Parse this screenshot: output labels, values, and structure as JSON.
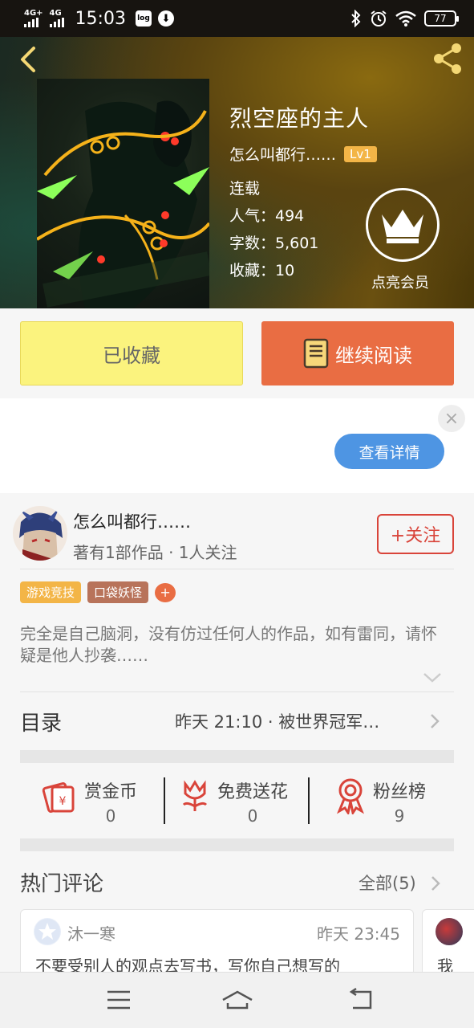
{
  "status_bar": {
    "signal1": "4G+",
    "signal2": "4G",
    "time": "15:03",
    "log_badge": "log",
    "battery": "77"
  },
  "book": {
    "title": "烈空座的主人",
    "author": "怎么叫都行……",
    "level": "Lv1",
    "status": "连载",
    "popularity": "人气：494",
    "words": "字数：5,601",
    "favorites": "收藏：10",
    "vip_label": "点亮会员"
  },
  "actions": {
    "favorited_label": "已收藏",
    "continue_label": "继续阅读"
  },
  "ad": {
    "details_label": "查看详情"
  },
  "author": {
    "name": "怎么叫都行……",
    "meta": "著有1部作品 · 1人关注",
    "follow_label": "+关注",
    "tags": [
      {
        "label": "游戏竞技",
        "color": "#f3b547"
      },
      {
        "label": "口袋妖怪",
        "color": "#b8735a"
      }
    ],
    "tag_plus": "+",
    "description": "完全是自己脑洞，没有仿过任何人的作品，如有雷同，请怀疑是他人抄袭……"
  },
  "catalog": {
    "title": "目录",
    "latest": "昨天 21:10 · 被世界冠军…"
  },
  "stats": [
    {
      "label": "赏金币",
      "value": "0",
      "icon": "red-envelope-icon"
    },
    {
      "label": "免费送花",
      "value": "0",
      "icon": "flower-icon"
    },
    {
      "label": "粉丝榜",
      "value": "9",
      "icon": "ribbon-medal-icon"
    }
  ],
  "comments": {
    "title": "热门评论",
    "all_label": "全部(5)",
    "items": [
      {
        "user": "沐一寒",
        "time": "昨天 23:45",
        "text": "不要受别人的观点去写书，写你自己想写的"
      },
      {
        "text": "我"
      }
    ]
  },
  "colors": {
    "accent_orange": "#e96d43",
    "favorite_yellow": "#fbf37e",
    "follow_red": "#d9443a",
    "ad_blue": "#4e95e3"
  }
}
